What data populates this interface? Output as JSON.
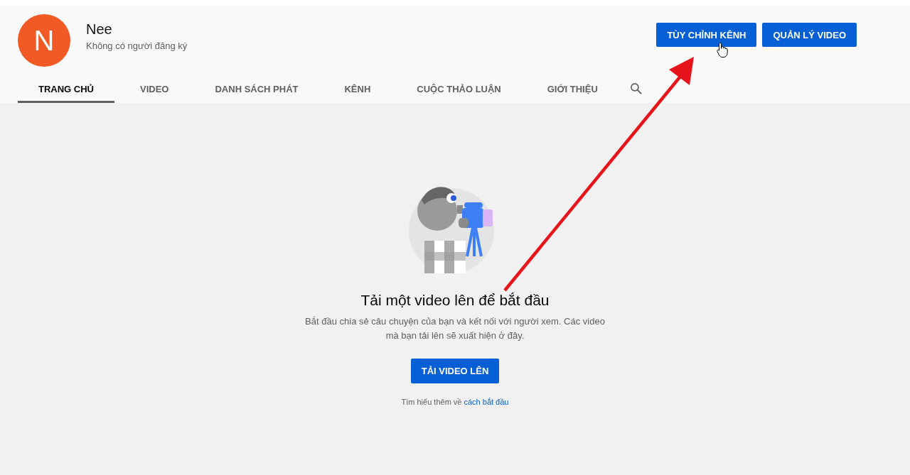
{
  "channel": {
    "avatar_letter": "N",
    "name": "Nee",
    "subscribers": "Không có người đăng ký"
  },
  "actions": [
    {
      "label": "TÙY CHỈNH KÊNH",
      "pointer": true
    },
    {
      "label": "QUẢN LÝ VIDEO",
      "pointer": false
    }
  ],
  "tabs": [
    {
      "label": "TRANG CHỦ",
      "selected": true
    },
    {
      "label": "VIDEO",
      "selected": false
    },
    {
      "label": "DANH SÁCH PHÁT",
      "selected": false
    },
    {
      "label": "KÊNH",
      "selected": false
    },
    {
      "label": "CUỘC THẢO LUẬN",
      "selected": false
    },
    {
      "label": "GIỚI THIỆU",
      "selected": false
    }
  ],
  "empty_state": {
    "title": "Tải một video lên để bắt đầu",
    "description": "Bắt đầu chia sẻ câu chuyện của bạn và kết nối với người xem. Các video mà bạn tải lên sẽ xuất hiện ở đây.",
    "button": "TẢI VIDEO LÊN",
    "help_text": "Tìm hiểu thêm về",
    "help_link": "cách bắt đầu"
  },
  "annotation": {
    "arrow": true
  }
}
